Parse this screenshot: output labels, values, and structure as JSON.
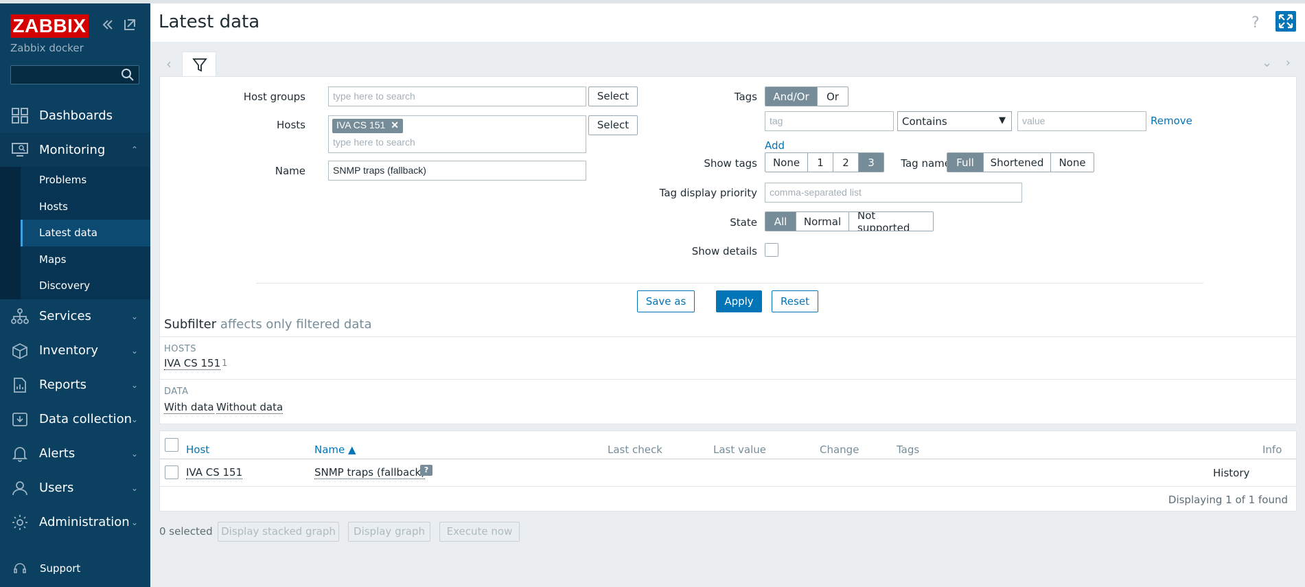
{
  "sidebar": {
    "logo": "ZABBIX",
    "server_name": "Zabbix docker",
    "search_placeholder": "",
    "nav": [
      {
        "label": "Dashboards"
      },
      {
        "label": "Monitoring"
      },
      {
        "label": "Services"
      },
      {
        "label": "Inventory"
      },
      {
        "label": "Reports"
      },
      {
        "label": "Data collection"
      },
      {
        "label": "Alerts"
      },
      {
        "label": "Users"
      },
      {
        "label": "Administration"
      }
    ],
    "monitoring_submenu": [
      "Problems",
      "Hosts",
      "Latest data",
      "Maps",
      "Discovery"
    ],
    "support": "Support"
  },
  "header": {
    "title": "Latest data",
    "help": "?"
  },
  "filter": {
    "host_groups_label": "Host groups",
    "host_groups_placeholder": "type here to search",
    "select_label": "Select",
    "hosts_label": "Hosts",
    "hosts_chip": "IVA CS 151",
    "hosts_placeholder": "type here to search",
    "name_label": "Name",
    "name_value": "SNMP traps (fallback)",
    "tags_label": "Tags",
    "tags_mode": [
      "And/Or",
      "Or"
    ],
    "tag_placeholder": "tag",
    "tag_operator": "Contains",
    "value_placeholder": "value",
    "remove_label": "Remove",
    "add_label": "Add",
    "show_tags_label": "Show tags",
    "show_tags_options": [
      "None",
      "1",
      "2",
      "3"
    ],
    "tag_name_label": "Tag name",
    "tag_name_options": [
      "Full",
      "Shortened",
      "None"
    ],
    "tag_priority_label": "Tag display priority",
    "tag_priority_placeholder": "comma-separated list",
    "state_label": "State",
    "state_options": [
      "All",
      "Normal",
      "Not supported"
    ],
    "show_details_label": "Show details",
    "save_as": "Save as",
    "apply": "Apply",
    "reset": "Reset"
  },
  "subfilter": {
    "title": "Subfilter",
    "subtitle": "affects only filtered data",
    "hosts_head": "HOSTS",
    "host_item": "IVA CS 151",
    "host_count": "1",
    "data_head": "DATA",
    "with_data": "With data",
    "without_data": "Without data"
  },
  "table": {
    "headers": {
      "host": "Host",
      "name": "Name ▲",
      "last_check": "Last check",
      "last_value": "Last value",
      "change": "Change",
      "tags": "Tags",
      "info": "Info"
    },
    "rows": [
      {
        "host": "IVA CS 151",
        "name": "SNMP traps (fallback)",
        "hint": "?",
        "history": "History"
      }
    ],
    "footer": "Displaying 1 of 1 found"
  },
  "actions": {
    "selected": "0 selected",
    "stacked_graph": "Display stacked graph",
    "graph": "Display graph",
    "execute": "Execute now"
  },
  "colors": {
    "sidebar_bg": "#0b4061",
    "accent": "#0275b8",
    "logo_red": "#d40000"
  }
}
